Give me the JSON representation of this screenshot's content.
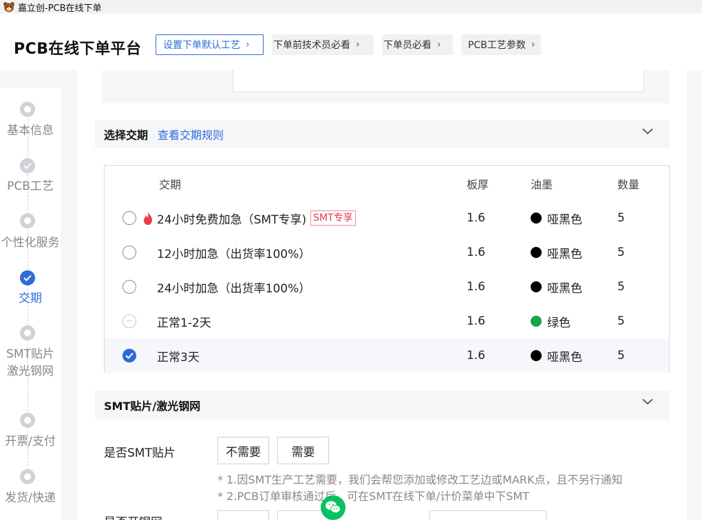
{
  "window": {
    "title": "嘉立创-PCB在线下单",
    "icon": "bear-logo-icon"
  },
  "header": {
    "brand": "PCB在线下单平台",
    "buttons": [
      {
        "label": "设置下单默认工艺"
      },
      {
        "label": "下单前技术员必看"
      },
      {
        "label": "下单员必看"
      },
      {
        "label": "PCB工艺参数"
      }
    ]
  },
  "steps": [
    {
      "label": "基本信息",
      "state": "pending"
    },
    {
      "label": "PCB工艺",
      "state": "done"
    },
    {
      "label": "个性化服务",
      "state": "pending"
    },
    {
      "label": "交期",
      "state": "active"
    },
    {
      "label": "SMT贴片\n激光钢网",
      "label_lines": [
        "SMT贴片",
        "激光钢网"
      ],
      "state": "pending"
    },
    {
      "label": "开票/支付",
      "state": "pending"
    },
    {
      "label": "发货/快递",
      "state": "pending"
    }
  ],
  "delivery": {
    "title": "选择交期",
    "rules_link": "查看交期规则",
    "columns": {
      "period": "交期",
      "thickness": "板厚",
      "ink": "油墨",
      "qty": "数量"
    },
    "rows": [
      {
        "name": "24小时免费加急（SMT专享)",
        "tag": "SMT专享",
        "hot": true,
        "thickness": "1.6",
        "ink": "哑黑色",
        "ink_color": "#000000",
        "qty": "5",
        "state": "unchecked"
      },
      {
        "name": "12小时加急（出货率100%）",
        "thickness": "1.6",
        "ink": "哑黑色",
        "ink_color": "#000000",
        "qty": "5",
        "state": "unchecked"
      },
      {
        "name": "24小时加急（出货率100%）",
        "thickness": "1.6",
        "ink": "哑黑色",
        "ink_color": "#000000",
        "qty": "5",
        "state": "unchecked"
      },
      {
        "name": "正常1-2天",
        "thickness": "1.6",
        "ink": "绿色",
        "ink_color": "#16a34a",
        "qty": "5",
        "state": "disabled"
      },
      {
        "name": "正常3天",
        "thickness": "1.6",
        "ink": "哑黑色",
        "ink_color": "#000000",
        "qty": "5",
        "state": "checked"
      }
    ]
  },
  "smt": {
    "title": "SMT贴片/激光钢网",
    "question": "是否SMT贴片",
    "options": [
      "不需要",
      "需要"
    ],
    "notes": [
      "* 1.因SMT生产工艺需要，我们会帮您添加或修改工艺边或MARK点，且不另行通知",
      "* 2.PCB订单审核通过后，可在SMT在线下单/计价菜单中下SMT"
    ],
    "next_label": "是否开钢网"
  },
  "colors": {
    "accent": "#2f6bd8",
    "tag_red": "#e03a4d",
    "wechat": "#07c160"
  }
}
